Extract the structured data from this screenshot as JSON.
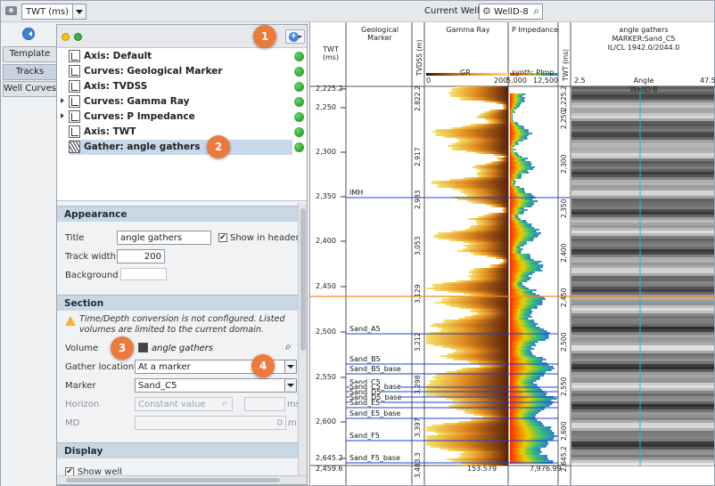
{
  "toolbar": {
    "domain_value": "TWT (ms)",
    "current_well_label": "Current Well",
    "current_well_value": "WellD-8"
  },
  "side_tabs": [
    "Template",
    "Tracks",
    "Well Curves"
  ],
  "tracks": [
    {
      "label": "Axis: Default",
      "expand": false
    },
    {
      "label": "Curves: Geological Marker",
      "expand": false
    },
    {
      "label": "Axis: TVDSS",
      "expand": false
    },
    {
      "label": "Curves: Gamma Ray",
      "expand": true
    },
    {
      "label": "Curves: P Impedance",
      "expand": true
    },
    {
      "label": "Axis: TWT",
      "expand": false
    },
    {
      "label": "Gather: angle gathers",
      "expand": false
    }
  ],
  "callouts": [
    "1",
    "2",
    "3",
    "4"
  ],
  "appearance": {
    "section": "Appearance",
    "title_label": "Title",
    "title_value": "angle gathers",
    "show_in_header": "Show in header",
    "width_label": "Track width",
    "width_value": "200",
    "background_label": "Background"
  },
  "section": {
    "section": "Section",
    "warning": "Time/Depth conversion is not configured. Listed volumes are limited to the current domain.",
    "volume_label": "Volume",
    "volume_value": "angle gathers",
    "gather_loc_label": "Gather location",
    "gather_loc_value": "At a marker",
    "marker_label": "Marker",
    "marker_value": "Sand_C5",
    "horizon_label": "Horizon",
    "horizon_value": "Constant value",
    "horizon_unit": "ms",
    "md_label": "MD",
    "md_value": "0",
    "md_unit": "m"
  },
  "display": {
    "section": "Display",
    "show_well": "Show well"
  },
  "plot": {
    "twt_header": "TWT\n(ms)",
    "geo_header": "Geological Marker",
    "tvdss_header": "TVDSS (m)",
    "gr_header": "Gamma Ray",
    "gr_curve": "GR",
    "gr_min": "0",
    "gr_max": "200",
    "pi_header": "P Impedance",
    "pi_curve": "synth: PImp",
    "pi_min": "5,000",
    "pi_max": "12,500",
    "twt2_header": "TWT (ms)",
    "gather_header": "angle gathers",
    "gather_sub1": "MARKER:Sand_C5",
    "gather_sub2": "IL/CL 1942.0/2044.0",
    "angle_min": "2.5",
    "angle_label": "Angle",
    "angle_max": "47.5",
    "well_tag": "WellD-8",
    "twt_ticks": [
      "2,225.2",
      "2,250",
      "2,300",
      "2,350",
      "2,400",
      "2,450",
      "2,500",
      "2,550",
      "2,600",
      "2,645.2",
      "2,459.6"
    ],
    "tvdss_ticks": [
      "2,822.2",
      "2,917",
      "2,983",
      "3,053",
      "3,129",
      "3,212",
      "3,298",
      "3,397",
      "3,483.3"
    ],
    "twt2_ticks": [
      "2,225.2",
      "2,250",
      "2,300",
      "2,350",
      "2,400",
      "2,450",
      "2,500",
      "2,550",
      "2,600",
      "2,645.2"
    ],
    "gr_foot": "153.579",
    "pi_foot": "7,976.99",
    "markers": [
      "IMH",
      "Sand_A5",
      "Sand_B5",
      "Sand_B5_base",
      "Sand_C5",
      "Sand_C5_base",
      "Sand_D5",
      "Sand_D5_base",
      "Sand_E5",
      "Sand_E5_base",
      "Sand_F5",
      "Sand_F5_base"
    ]
  },
  "colors": {
    "accent": "#3e83d8",
    "callout": "#ec7a3c",
    "led": "#1a8a1a",
    "section_bg": "#c9d6e3",
    "marker_line": "#1f3fd0",
    "horizon_orange": "#f08a1a"
  }
}
